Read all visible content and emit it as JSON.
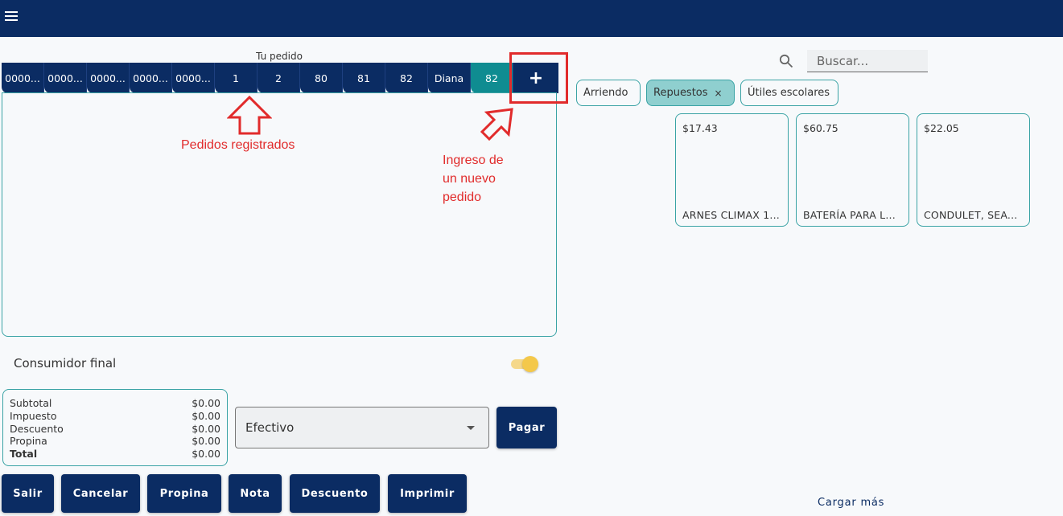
{
  "header": {
    "menu_icon": "hamburger-icon",
    "background": "#0b2c63"
  },
  "order": {
    "title": "Tu pedido",
    "tabs": [
      "0000...",
      "0000...",
      "0000...",
      "0000...",
      "0000...",
      "1",
      "2",
      "80",
      "81",
      "82",
      "Diana",
      "82"
    ],
    "active_tab_index": 11,
    "add_label": "+",
    "active_color": "#0f8c91"
  },
  "annotations": {
    "registered": "Pedidos registrados",
    "new_line1": "Ingreso de",
    "new_line2": "un nuevo",
    "new_line3": "pedido",
    "color": "#e12b2b"
  },
  "customer": {
    "label": "Consumidor final",
    "toggle_on": true
  },
  "totals": {
    "subtotal_label": "Subtotal",
    "subtotal": "$0.00",
    "tax_label": "Impuesto",
    "tax": "$0.00",
    "discount_label": "Descuento",
    "discount": "$0.00",
    "tip_label": "Propina",
    "tip": "$0.00",
    "total_label": "Total",
    "total": "$0.00"
  },
  "payment": {
    "selected": "Efectivo",
    "pay_label": "Pagar"
  },
  "actions": {
    "exit": "Salir",
    "cancel": "Cancelar",
    "tip": "Propina",
    "note": "Nota",
    "discount": "Descuento",
    "print": "Imprimir"
  },
  "search": {
    "placeholder": "Buscar...",
    "icon": "search-icon"
  },
  "categories": [
    {
      "label": "Arriendo",
      "selected": false
    },
    {
      "label": "Repuestos",
      "selected": true
    },
    {
      "label": "Útiles escolares",
      "selected": false
    }
  ],
  "chip_remove": "×",
  "products": [
    {
      "price": "$17.43",
      "name": "ARNES CLIMAX 1..."
    },
    {
      "price": "$60.75",
      "name": "BATERÍA PARA L..."
    },
    {
      "price": "$22.05",
      "name": "CONDULET, SEA..."
    }
  ],
  "load_more": "Cargar más"
}
